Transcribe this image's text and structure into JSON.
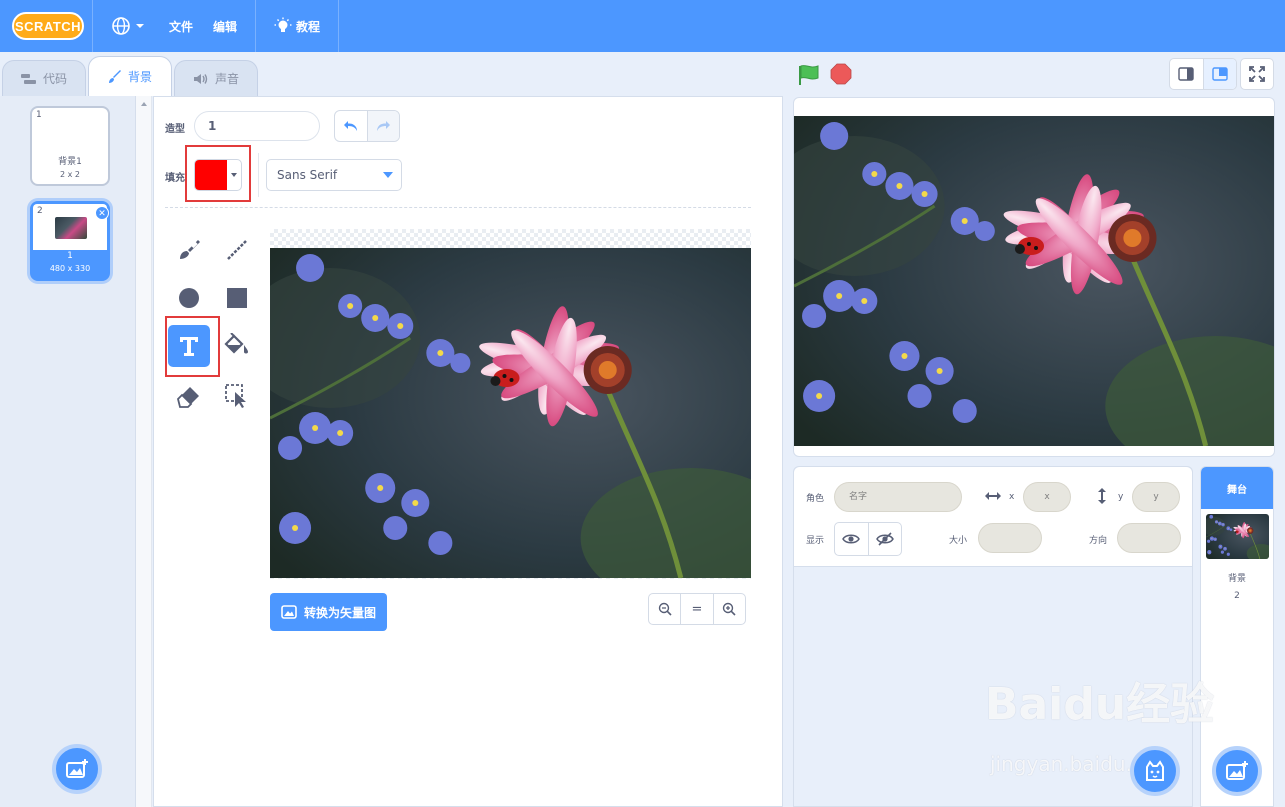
{
  "menubar": {
    "logo_text": "SCRATCH",
    "file_label": "文件",
    "edit_label": "编辑",
    "tutorials_label": "教程"
  },
  "tabs": [
    {
      "label": "代码",
      "active": false
    },
    {
      "label": "背景",
      "active": true
    },
    {
      "label": "声音",
      "active": false
    }
  ],
  "costumes": [
    {
      "number": "1",
      "name": "背景1",
      "size": "2 x 2",
      "selected": false
    },
    {
      "number": "2",
      "name": "1",
      "size": "480 x 330",
      "selected": true
    }
  ],
  "editor": {
    "costume_label": "造型",
    "costume_name_value": "1",
    "fill_label": "填充",
    "fill_color": "#ff0000",
    "font_value": "Sans Serif",
    "convert_button_label": "转换为矢量图",
    "zoom_reset_label": "="
  },
  "tools": [
    {
      "name": "brush",
      "active": false
    },
    {
      "name": "line",
      "active": false
    },
    {
      "name": "circle",
      "active": false
    },
    {
      "name": "rectangle",
      "active": false
    },
    {
      "name": "text",
      "active": true
    },
    {
      "name": "fill",
      "active": false
    },
    {
      "name": "eraser",
      "active": false
    },
    {
      "name": "select",
      "active": false
    }
  ],
  "sprite_info": {
    "sprite_label": "角色",
    "name_placeholder": "名字",
    "x_label": "x",
    "x_placeholder": "x",
    "y_label": "y",
    "y_placeholder": "y",
    "show_label": "显示",
    "size_label": "大小",
    "direction_label": "方向"
  },
  "stage_target": {
    "header": "舞台",
    "backdrops_label": "背景",
    "backdrops_count": "2"
  },
  "watermark": {
    "main": "Baidu经验",
    "sub": "jingyan.baidu.com"
  },
  "colors": {
    "accent": "#4c97ff",
    "highlight_box": "#e23b3b",
    "flag": "#4cbf56",
    "stop": "#ec5959"
  }
}
